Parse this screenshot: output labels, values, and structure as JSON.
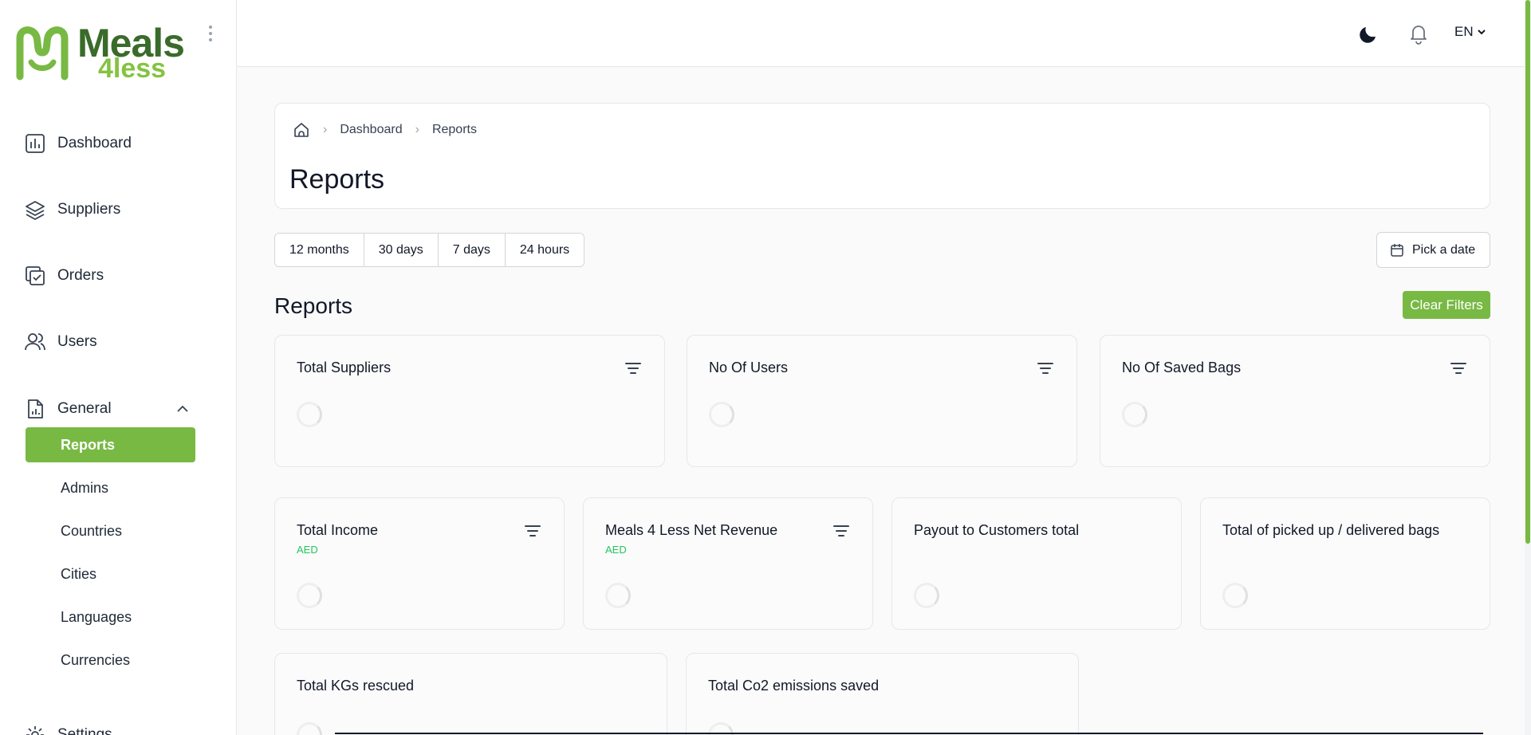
{
  "brand": {
    "line1": "Meals",
    "line2": "4less",
    "primary": "#3a6b2a",
    "accent": "#84c341"
  },
  "sidebar": {
    "items": [
      {
        "label": "Dashboard",
        "icon": "bar-chart-icon"
      },
      {
        "label": "Suppliers",
        "icon": "layers-icon"
      },
      {
        "label": "Orders",
        "icon": "clipboard-check-icon"
      },
      {
        "label": "Users",
        "icon": "users-icon"
      },
      {
        "label": "General",
        "icon": "file-chart-icon"
      }
    ],
    "general_sub": [
      "Reports",
      "Admins",
      "Countries",
      "Cities",
      "Languages",
      "Currencies"
    ],
    "settings_label": "Settings"
  },
  "topbar": {
    "language": "EN"
  },
  "header": {
    "breadcrumb": [
      "Dashboard",
      "Reports"
    ],
    "title": "Reports"
  },
  "range_filters": [
    "12 months",
    "30 days",
    "7 days",
    "24 hours"
  ],
  "pick_date_label": "Pick a date",
  "section_title": "Reports",
  "clear_filters_label": "Clear Filters",
  "cards_row1": [
    {
      "title": "Total Suppliers"
    },
    {
      "title": "No Of Users"
    },
    {
      "title": "No Of Saved Bags"
    }
  ],
  "cards_row2": [
    {
      "title": "Total Income",
      "sub": "AED"
    },
    {
      "title": "Meals 4 Less Net Revenue",
      "sub": "AED"
    },
    {
      "title": "Payout to Customers total"
    },
    {
      "title": "Total of picked up / delivered bags"
    }
  ],
  "cards_row3": [
    {
      "title": "Total KGs rescued"
    },
    {
      "title": "Total Co2 emissions saved"
    }
  ]
}
